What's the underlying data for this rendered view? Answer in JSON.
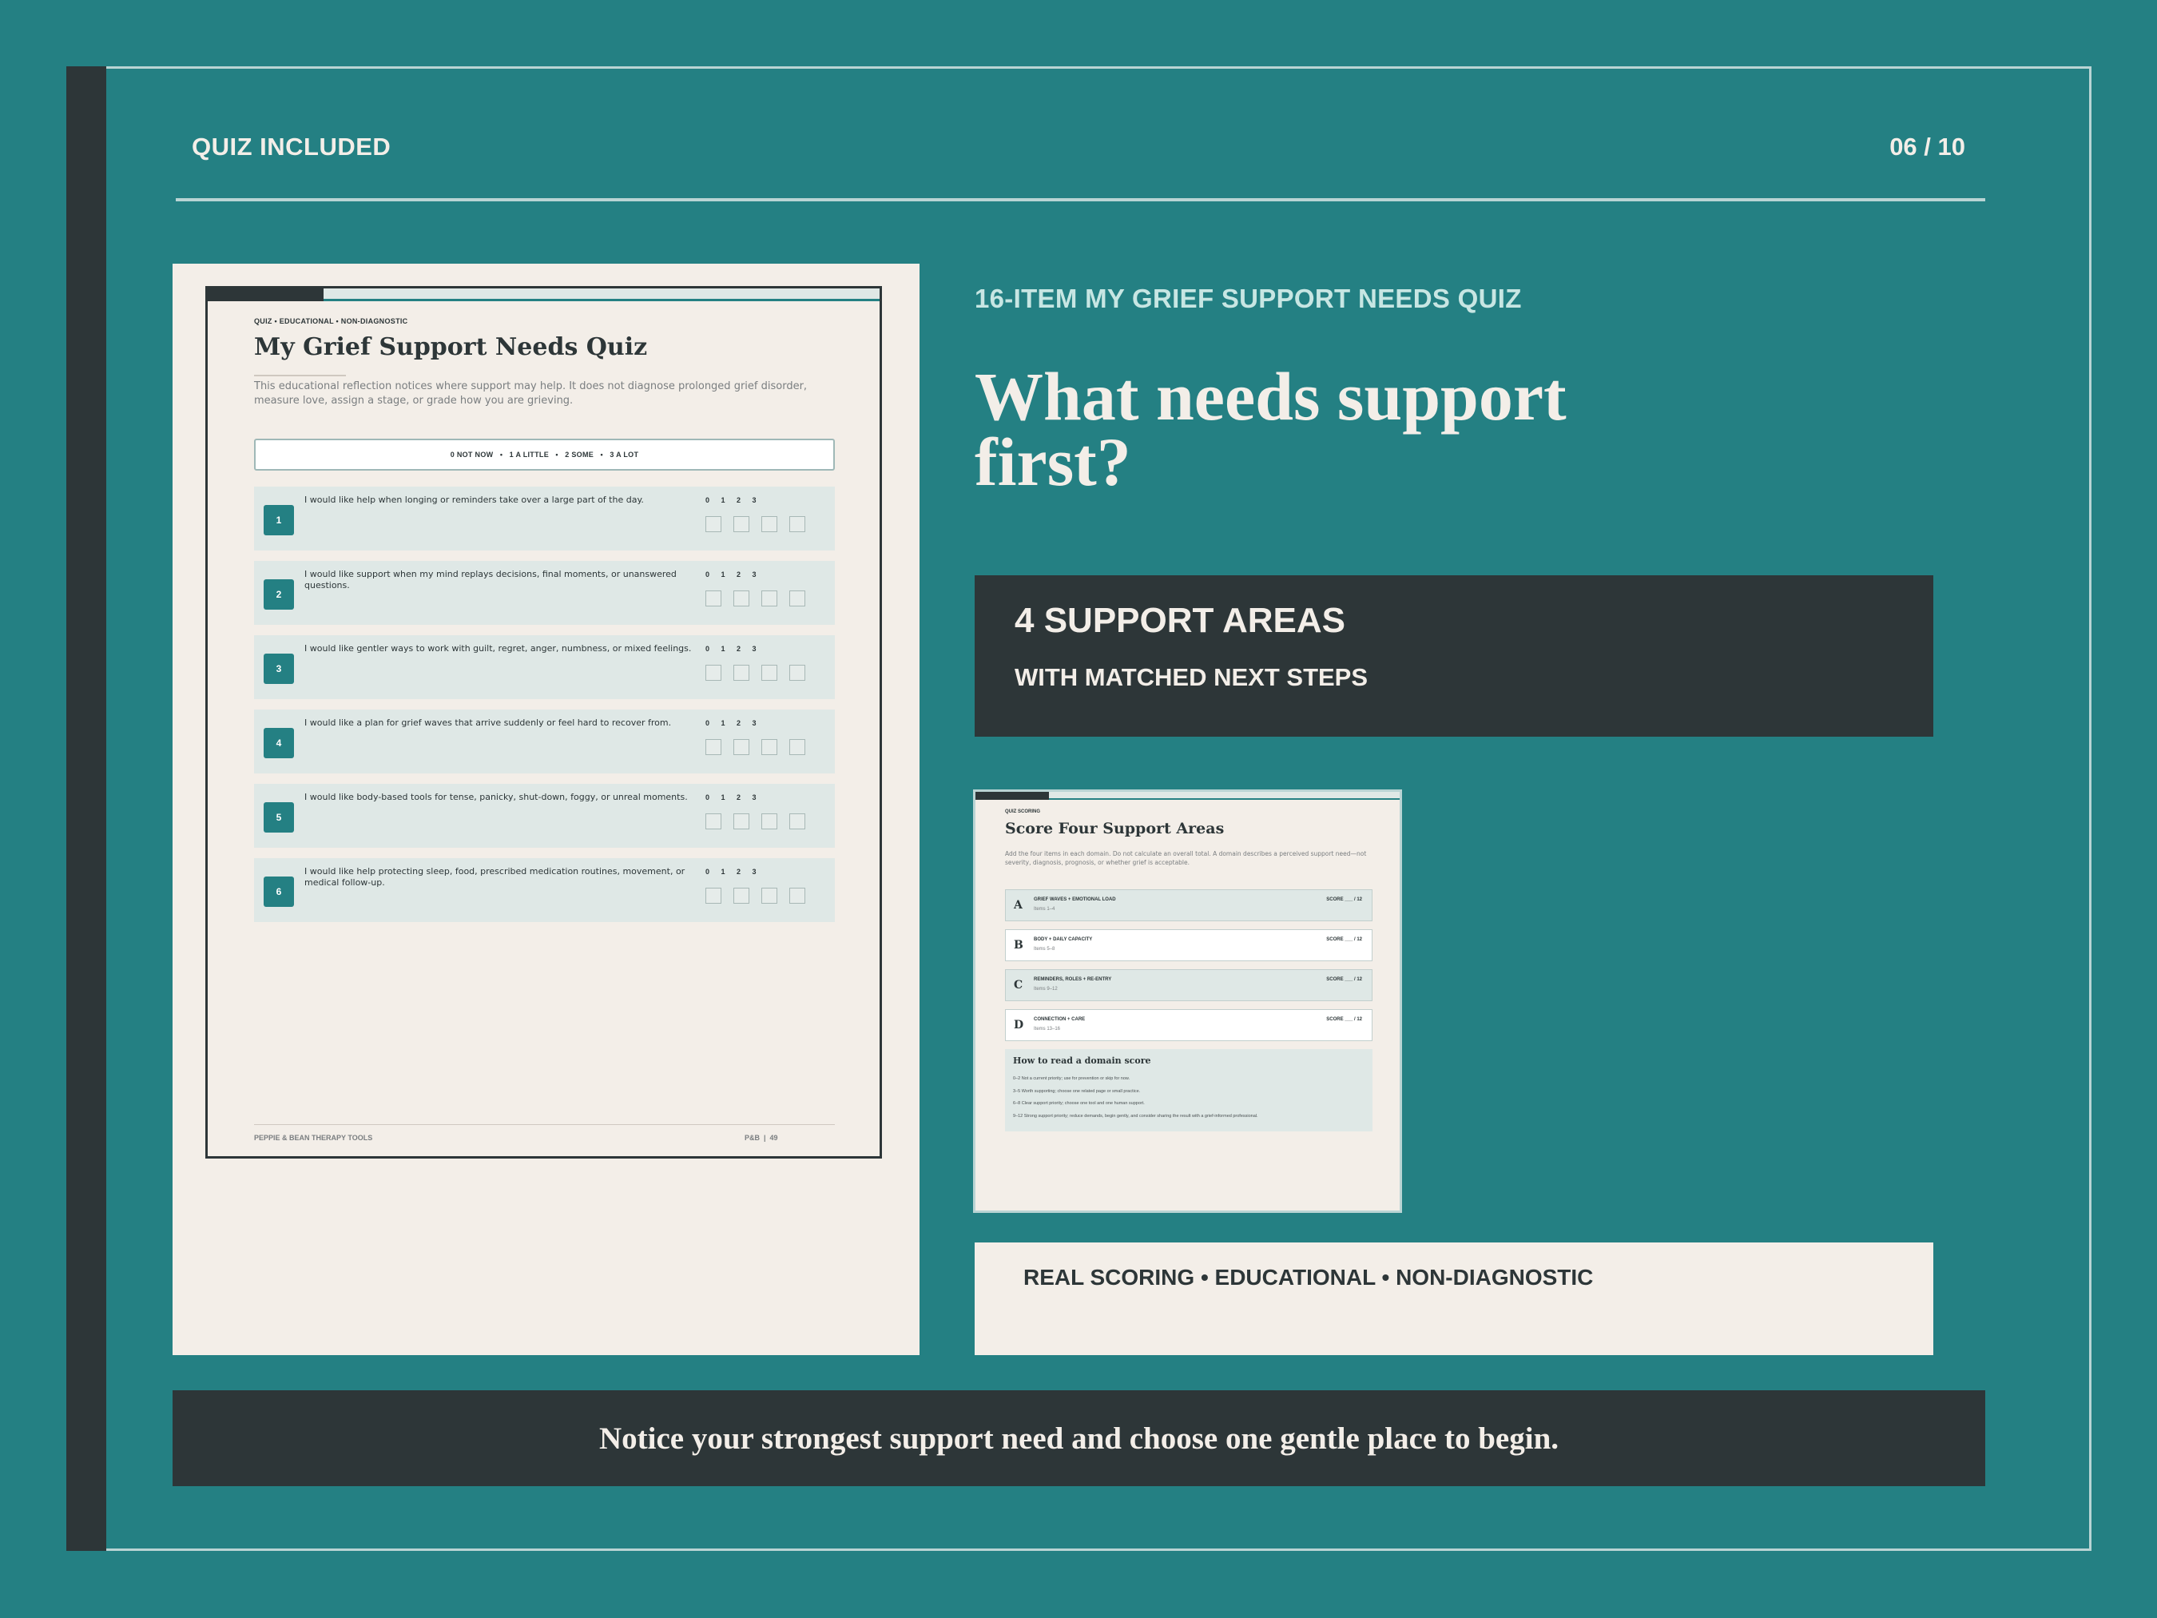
{
  "header": {
    "label": "QUIZ INCLUDED",
    "page_counter": "06 / 10"
  },
  "quiz_page": {
    "eyebrow": "QUIZ • EDUCATIONAL • NON-DIAGNOSTIC",
    "title": "My Grief Support Needs Quiz",
    "intro": "This educational reflection notices where support may help. It does not diagnose prolonged grief disorder, measure love, assign a stage, or grade how you are grieving.",
    "scale_legend": "0 NOT NOW   •   1 A LITTLE   •   2 SOME   •   3 A LOT",
    "scale_numbers": "0 1 2 3",
    "items": [
      {
        "num": "1",
        "text": "I would like help when longing or reminders take over a large part of the day."
      },
      {
        "num": "2",
        "text": "I would like support when my mind replays decisions, final moments, or unanswered questions."
      },
      {
        "num": "3",
        "text": "I would like gentler ways to work with guilt, regret, anger, numbness, or mixed feelings."
      },
      {
        "num": "4",
        "text": "I would like a plan for grief waves that arrive suddenly or feel hard to recover from."
      },
      {
        "num": "5",
        "text": "I would like body-based tools for tense, panicky, shut-down, foggy, or unreal moments."
      },
      {
        "num": "6",
        "text": "I would like help protecting sleep, food, prescribed medication routines, movement, or medical follow-up."
      }
    ],
    "footer_left": "PEPPIE & BEAN THERAPY TOOLS",
    "footer_right": "P&B  |  49"
  },
  "main": {
    "eyebrow": "16-ITEM MY GRIEF SUPPORT NEEDS QUIZ",
    "headline": "What needs support first?",
    "areas_title": "4 SUPPORT AREAS",
    "areas_sub": "WITH MATCHED NEXT STEPS",
    "tagline": "REAL SCORING • EDUCATIONAL • NON-DIAGNOSTIC"
  },
  "scoring_page": {
    "eyebrow": "QUIZ SCORING",
    "title": "Score Four Support Areas",
    "intro": "Add the four items in each domain. Do not calculate an overall total. A domain describes a perceived support need—not severity, diagnosis, prognosis, or whether grief is acceptable.",
    "domains": [
      {
        "letter": "A",
        "name": "GRIEF WAVES + EMOTIONAL LOAD",
        "items": "Items 1–4",
        "score": "SCORE ___ / 12"
      },
      {
        "letter": "B",
        "name": "BODY + DAILY CAPACITY",
        "items": "Items 5–8",
        "score": "SCORE ___ / 12"
      },
      {
        "letter": "C",
        "name": "REMINDERS, ROLES + RE-ENTRY",
        "items": "Items 9–12",
        "score": "SCORE ___ / 12"
      },
      {
        "letter": "D",
        "name": "CONNECTION + CARE",
        "items": "Items 13–16",
        "score": "SCORE ___ / 12"
      }
    ],
    "howto_title": "How to read a domain score",
    "howto_lines": [
      "0–2 Not a current priority; use for prevention or skip for now.",
      "3–5 Worth supporting; choose one related page or small practice.",
      "6–8 Clear support priority; choose one tool and one human support.",
      "9–12 Strong support priority; reduce demands, begin gently, and consider sharing the result with a grief-informed professional."
    ]
  },
  "bottom": {
    "message": "Notice your strongest support need and choose one gentle place to begin."
  },
  "colors": {
    "background": "#248083",
    "dark": "#2d3638",
    "cream": "#f3eee8",
    "light_teal": "#dfe8e6",
    "eyebrow_teal": "#c7e6e3"
  }
}
